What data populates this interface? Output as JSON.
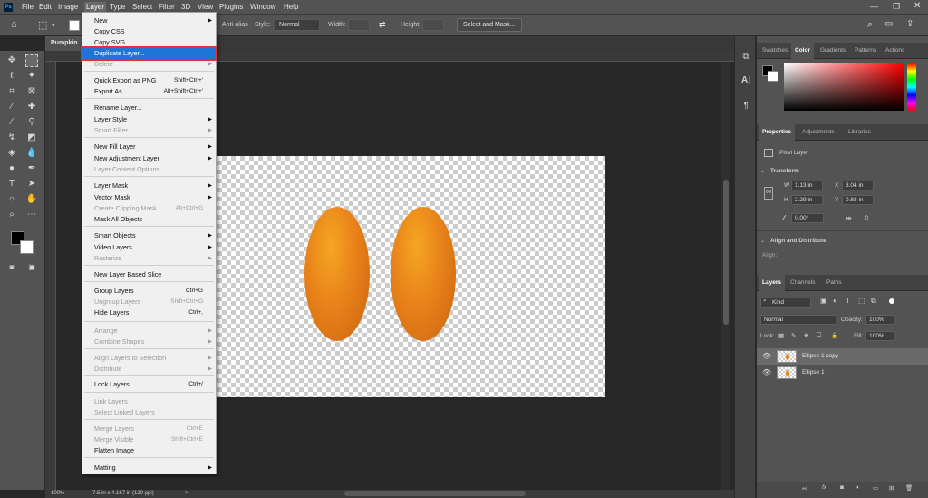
{
  "menubar": {
    "logo": "Ps",
    "items": [
      "File",
      "Edit",
      "Image",
      "Layer",
      "Type",
      "Select",
      "Filter",
      "3D",
      "View",
      "Plugins",
      "Window",
      "Help"
    ]
  },
  "options": {
    "antialias": "Anti-alias",
    "style_label": "Style:",
    "style_value": "Normal",
    "width_label": "Width:",
    "height_label": "Height:",
    "select_mask": "Select and Mask..."
  },
  "tab": {
    "title": "Pumpkin"
  },
  "status": {
    "zoom": "100%",
    "docsize": "7.5 in x 4.167 in (120 ppi)"
  },
  "dropdown": {
    "items": [
      {
        "label": "New",
        "shortcut": "",
        "sub": true,
        "disabled": false
      },
      {
        "label": "Copy CSS",
        "shortcut": "",
        "sub": false,
        "disabled": false
      },
      {
        "label": "Copy SVG",
        "shortcut": "",
        "sub": false,
        "disabled": false
      },
      {
        "label": "Duplicate Layer...",
        "shortcut": "",
        "sub": false,
        "disabled": false,
        "highlight": true
      },
      {
        "label": "Delete",
        "shortcut": "",
        "sub": true,
        "disabled": true
      },
      {
        "label": "Quick Export as PNG",
        "shortcut": "Shift+Ctrl+'",
        "sub": false,
        "disabled": false
      },
      {
        "label": "Export As...",
        "shortcut": "Alt+Shift+Ctrl+'",
        "sub": false,
        "disabled": false
      },
      {
        "label": "Rename Layer...",
        "shortcut": "",
        "sub": false,
        "disabled": false
      },
      {
        "label": "Layer Style",
        "shortcut": "",
        "sub": true,
        "disabled": false
      },
      {
        "label": "Smart Filter",
        "shortcut": "",
        "sub": true,
        "disabled": true
      },
      {
        "label": "New Fill Layer",
        "shortcut": "",
        "sub": true,
        "disabled": false
      },
      {
        "label": "New Adjustment Layer",
        "shortcut": "",
        "sub": true,
        "disabled": false
      },
      {
        "label": "Layer Content Options...",
        "shortcut": "",
        "sub": false,
        "disabled": true
      },
      {
        "label": "Layer Mask",
        "shortcut": "",
        "sub": true,
        "disabled": false
      },
      {
        "label": "Vector Mask",
        "shortcut": "",
        "sub": true,
        "disabled": false
      },
      {
        "label": "Create Clipping Mask",
        "shortcut": "Alt+Ctrl+G",
        "sub": false,
        "disabled": true
      },
      {
        "label": "Mask All Objects",
        "shortcut": "",
        "sub": false,
        "disabled": false
      },
      {
        "label": "Smart Objects",
        "shortcut": "",
        "sub": true,
        "disabled": false
      },
      {
        "label": "Video Layers",
        "shortcut": "",
        "sub": true,
        "disabled": false
      },
      {
        "label": "Rasterize",
        "shortcut": "",
        "sub": true,
        "disabled": true
      },
      {
        "label": "New Layer Based Slice",
        "shortcut": "",
        "sub": false,
        "disabled": false
      },
      {
        "label": "Group Layers",
        "shortcut": "Ctrl+G",
        "sub": false,
        "disabled": false
      },
      {
        "label": "Ungroup Layers",
        "shortcut": "Shift+Ctrl+G",
        "sub": false,
        "disabled": true
      },
      {
        "label": "Hide Layers",
        "shortcut": "Ctrl+,",
        "sub": false,
        "disabled": false
      },
      {
        "label": "Arrange",
        "shortcut": "",
        "sub": true,
        "disabled": true
      },
      {
        "label": "Combine Shapes",
        "shortcut": "",
        "sub": true,
        "disabled": true
      },
      {
        "label": "Align Layers to Selection",
        "shortcut": "",
        "sub": true,
        "disabled": true
      },
      {
        "label": "Distribute",
        "shortcut": "",
        "sub": true,
        "disabled": true
      },
      {
        "label": "Lock Layers...",
        "shortcut": "Ctrl+/",
        "sub": false,
        "disabled": false
      },
      {
        "label": "Link Layers",
        "shortcut": "",
        "sub": false,
        "disabled": true
      },
      {
        "label": "Select Linked Layers",
        "shortcut": "",
        "sub": false,
        "disabled": true
      },
      {
        "label": "Merge Layers",
        "shortcut": "Ctrl+E",
        "sub": false,
        "disabled": true
      },
      {
        "label": "Merge Visible",
        "shortcut": "Shift+Ctrl+E",
        "sub": false,
        "disabled": true
      },
      {
        "label": "Flatten Image",
        "shortcut": "",
        "sub": false,
        "disabled": false
      },
      {
        "label": "Matting",
        "shortcut": "",
        "sub": true,
        "disabled": false
      }
    ]
  },
  "color_panel": {
    "tabs": [
      "Swatches",
      "Color",
      "Gradients",
      "Patterns",
      "Actions"
    ],
    "active": "Color"
  },
  "properties": {
    "tabs": [
      "Properties",
      "Adjustments",
      "Libraries"
    ],
    "active": "Properties",
    "kind": "Pixel Layer",
    "transform_label": "Transform",
    "w_label": "W",
    "w": "1.13 in",
    "x_label": "X",
    "x": "3.04 in",
    "h_label": "H",
    "h": "2.29 in",
    "y_label": "Y",
    "y": "0.83 in",
    "angle": "0.00°",
    "align_label": "Align and Distribute",
    "align_sub": "Align:"
  },
  "layers": {
    "tabs": [
      "Layers",
      "Channels",
      "Paths"
    ],
    "active": "Layers",
    "filter": "Kind",
    "blend": "Normal",
    "opacity_label": "Opacity:",
    "opacity": "100%",
    "lock_label": "Lock:",
    "fill_label": "Fill:",
    "fill": "100%",
    "rows": [
      {
        "name": "Ellipse 1 copy",
        "selected": true
      },
      {
        "name": "Ellipse 1",
        "selected": false
      }
    ]
  }
}
